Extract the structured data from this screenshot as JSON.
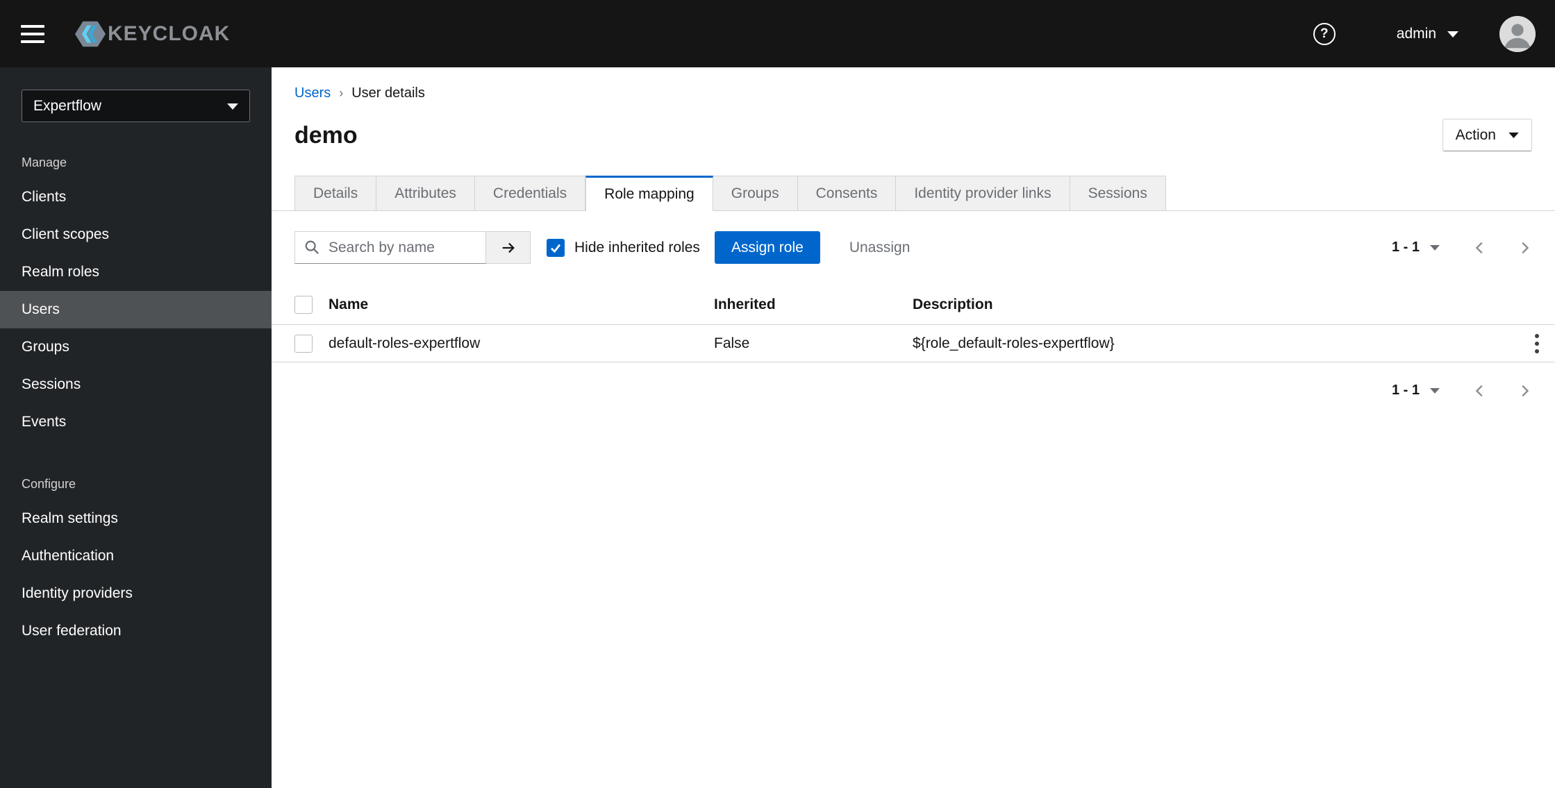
{
  "topbar": {
    "brand": "KEYCLOAK",
    "help_glyph": "?",
    "user": "admin"
  },
  "sidebar": {
    "realm_selector": "Expertflow",
    "active_item": "Users",
    "sections": [
      {
        "label": "Manage",
        "items": [
          "Clients",
          "Client scopes",
          "Realm roles",
          "Users",
          "Groups",
          "Sessions",
          "Events"
        ]
      },
      {
        "label": "Configure",
        "items": [
          "Realm settings",
          "Authentication",
          "Identity providers",
          "User federation"
        ]
      }
    ]
  },
  "breadcrumb": {
    "parent": "Users",
    "separator": "›",
    "current": "User details"
  },
  "header": {
    "title": "demo",
    "action_button": "Action"
  },
  "tabs": [
    "Details",
    "Attributes",
    "Credentials",
    "Role mapping",
    "Groups",
    "Consents",
    "Identity provider links",
    "Sessions"
  ],
  "active_tab": "Role mapping",
  "toolbar": {
    "search_placeholder": "Search by name",
    "hide_inherited_label": "Hide inherited roles",
    "hide_inherited_checked": true,
    "assign_button": "Assign role",
    "unassign_button": "Unassign",
    "pagination_range": "1 - 1"
  },
  "table": {
    "headers": {
      "name": "Name",
      "inherited": "Inherited",
      "description": "Description"
    },
    "rows": [
      {
        "name": "default-roles-expertflow",
        "inherited": "False",
        "description": "${role_default-roles-expertflow}"
      }
    ]
  },
  "footer": {
    "pagination_range": "1 - 1"
  },
  "icons": {
    "menu": "hamburger-icon",
    "brand": "keycloak-logo-icon",
    "help": "question-circle-icon",
    "dropdowns": "caret-down-icon",
    "search": "search-icon",
    "search_submit": "arrow-right-icon",
    "pagination_prev": "chevron-left-icon",
    "pagination_next": "chevron-right-icon",
    "row_actions": "kebab-icon",
    "avatar": "user-avatar-icon"
  },
  "colors": {
    "primary": "#0066cc",
    "link": "#0066cc",
    "masthead": "#151515",
    "sidebar": "#212427",
    "active_nav": "#4f5255",
    "inactive_tab_bg": "#f0f0f0",
    "border": "#d2d2d2",
    "muted_text": "#6a6e73"
  }
}
